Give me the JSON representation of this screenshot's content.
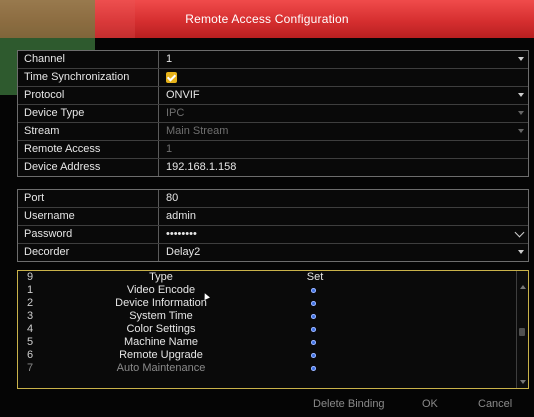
{
  "window": {
    "title": "Remote Access Configuration"
  },
  "settings": {
    "channel": {
      "label": "Channel",
      "value": "1"
    },
    "time_sync": {
      "label": "Time Synchronization",
      "checked": true
    },
    "protocol": {
      "label": "Protocol",
      "value": "ONVIF"
    },
    "device_type": {
      "label": "Device Type",
      "value": "IPC"
    },
    "stream": {
      "label": "Stream",
      "value": "Main Stream"
    },
    "remote_access": {
      "label": "Remote Access",
      "value": "1"
    },
    "device_address": {
      "label": "Device Address",
      "value": "192.168.1.158"
    }
  },
  "connection": {
    "port": {
      "label": "Port",
      "value": "80"
    },
    "username": {
      "label": "Username",
      "value": "admin"
    },
    "password": {
      "label": "Password",
      "value": "••••••••"
    },
    "decoder": {
      "label": "Decorder",
      "value": "Delay2"
    }
  },
  "table": {
    "headers": {
      "count": "9",
      "type": "Type",
      "set": "Set"
    },
    "rows": [
      {
        "num": "1",
        "type": "Video Encode"
      },
      {
        "num": "2",
        "type": "Device Information"
      },
      {
        "num": "3",
        "type": "System Time"
      },
      {
        "num": "4",
        "type": "Color Settings"
      },
      {
        "num": "5",
        "type": "Machine Name"
      },
      {
        "num": "6",
        "type": "Remote Upgrade"
      },
      {
        "num": "7",
        "type": "Auto Maintenance"
      }
    ]
  },
  "buttons": {
    "delete_binding": "Delete Binding",
    "ok": "OK",
    "cancel": "Cancel"
  },
  "colors": {
    "title_bar": "#d62f30",
    "checkbox": "#e6b21a",
    "table_border": "#c9b24a",
    "set_dot": "#3b6fe0"
  }
}
